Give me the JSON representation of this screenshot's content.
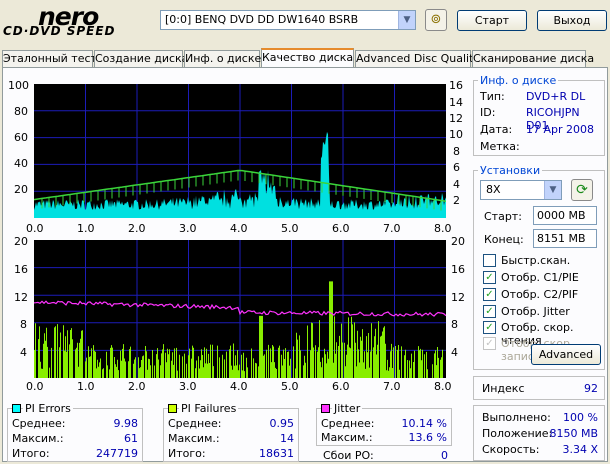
{
  "logo": {
    "top": "nero",
    "bottom": "CD·DVD SPEED"
  },
  "toolbar": {
    "drive": "[0:0]   BENQ DVD DD DW1640 BSRB",
    "start_label": "Старт",
    "exit_label": "Выход",
    "drive_icon": "disc-tray-icon"
  },
  "tabs": [
    "Эталонный тест",
    "Создание диска",
    "Инф. о диске",
    "Качество диска",
    "Advanced Disc Quality",
    "Сканирование диска"
  ],
  "active_tab": 3,
  "top_chart": {
    "y_left": [
      "100",
      "80",
      "60",
      "40",
      "20"
    ],
    "y_right": [
      "16",
      "14",
      "12",
      "10",
      "8",
      "6",
      "4",
      "2"
    ],
    "x": [
      "0.0",
      "1.0",
      "2.0",
      "3.0",
      "4.0",
      "5.0",
      "6.0",
      "7.0",
      "8.0"
    ]
  },
  "bottom_chart": {
    "y_left": [
      "20",
      "16",
      "12",
      "8",
      "4"
    ],
    "y_right": [
      "20",
      "16",
      "12",
      "8",
      "4"
    ],
    "x": [
      "0.0",
      "1.0",
      "2.0",
      "3.0",
      "4.0",
      "5.0",
      "6.0",
      "7.0",
      "8.0"
    ]
  },
  "disc_info": {
    "title": "Инф. о диске",
    "rows": [
      {
        "label": "Тип:",
        "value": "DVD+R DL"
      },
      {
        "label": "ID:",
        "value": "RICOHJPN D01"
      },
      {
        "label": "Дата:",
        "value": "17 Apr 2008"
      },
      {
        "label": "Метка:",
        "value": ""
      }
    ]
  },
  "settings": {
    "title": "Установки",
    "speed": "8X",
    "start_label": "Старт:",
    "start_value": "0000 MB",
    "end_label": "Конец:",
    "end_value": "8151 MB",
    "checks": [
      {
        "label": "Быстр.скан.",
        "checked": false,
        "enabled": true
      },
      {
        "label": "Отобр. C1/PIE",
        "checked": true,
        "enabled": true
      },
      {
        "label": "Отобр. C2/PIF",
        "checked": true,
        "enabled": true
      },
      {
        "label": "Отобр. Jitter",
        "checked": true,
        "enabled": true
      },
      {
        "label": "Отобр. скор. чтения",
        "checked": true,
        "enabled": true
      },
      {
        "label": "Отобр. скор. записи",
        "checked": true,
        "enabled": false
      }
    ],
    "advanced_label": "Advanced"
  },
  "index": {
    "label": "Индекс",
    "value": "92"
  },
  "progress": {
    "rows": [
      {
        "label": "Выполнено:",
        "value": "100 %"
      },
      {
        "label": "Положение:",
        "value": "8150 MB"
      },
      {
        "label": "Скорость:",
        "value": "3.34 X"
      }
    ]
  },
  "pi_errors": {
    "title": "PI Errors",
    "color": "#00ffff",
    "rows": [
      {
        "label": "Среднее:",
        "value": "9.98"
      },
      {
        "label": "Максим.:",
        "value": "61"
      },
      {
        "label": "Итого:",
        "value": "247719"
      }
    ]
  },
  "pi_failures": {
    "title": "PI Failures",
    "color": "#ccff00",
    "rows": [
      {
        "label": "Среднее:",
        "value": "0.95"
      },
      {
        "label": "Максим.:",
        "value": "14"
      },
      {
        "label": "Итого:",
        "value": "18631"
      }
    ]
  },
  "jitter": {
    "title": "Jitter",
    "color": "#ff33ff",
    "rows": [
      {
        "label": "Среднее:",
        "value": "10.14 %"
      },
      {
        "label": "Максим.:",
        "value": "13.6 %"
      }
    ]
  },
  "po_failures": {
    "label": "Сбои PO:",
    "value": "0"
  }
}
